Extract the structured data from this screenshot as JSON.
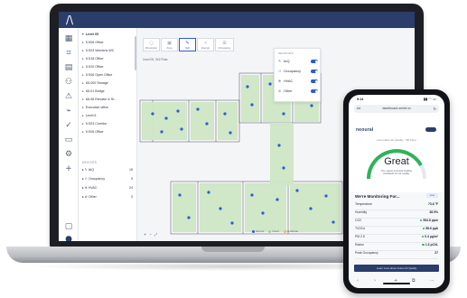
{
  "colors": {
    "brand_navy": "#2a3d6b",
    "accent_blue": "#2f5bd3",
    "plan_green": "#cfe7c6",
    "good_green": "#2fb35a"
  },
  "app": {
    "logo_glyph": "/\\",
    "rail_icons": [
      "building-icon",
      "floorplan-icon",
      "dashboard-icon",
      "people-icon",
      "alert-icon",
      "report-icon",
      "task-icon",
      "settings-icon",
      "add-icon",
      "chat-icon",
      "user-icon"
    ]
  },
  "tree": {
    "level": "Level 05",
    "items": [
      "5.S08 Office",
      "5.S03 Womens WC",
      "5.S18 Office",
      "5.S20 Office",
      "5.S06 Open Office",
      "A5.000 Storage",
      "A5.01 Bridge",
      "A5.06 Elevator & St...",
      "Executive office",
      "Level 6",
      "5.S03 Corridor",
      "5.S05 Office"
    ],
    "devices_label": "DEVICES",
    "devices": [
      {
        "name": "IAQ",
        "count": "15"
      },
      {
        "name": "Occupancy",
        "count": "5"
      },
      {
        "name": "HVAC",
        "count": "24"
      },
      {
        "name": "Other",
        "count": "3"
      }
    ]
  },
  "view_tabs": [
    {
      "label": "Dimension",
      "glyph": "▢"
    },
    {
      "label": "Area",
      "glyph": "▣"
    },
    {
      "label": "IAQ",
      "glyph": "✎"
    },
    {
      "label": "Energy",
      "glyph": "⚡"
    },
    {
      "label": "Occupancy",
      "glyph": "⊞"
    }
  ],
  "floor_caption": "Level 05, 3XZ Flats",
  "sensors_panel": {
    "header": "SENSORS",
    "rows": [
      {
        "label": "IAQ",
        "glyph": "✎"
      },
      {
        "label": "Occupancy",
        "glyph": "⚇"
      },
      {
        "label": "HVAC",
        "glyph": "❄"
      },
      {
        "label": "Other",
        "glyph": "⊘"
      }
    ]
  },
  "zoom": {
    "in": "+",
    "out": "−",
    "fit": "⤢"
  },
  "legend": [
    {
      "label": "Sensor"
    },
    {
      "label": "Good"
    },
    {
      "label": "Moderate"
    }
  ],
  "phone": {
    "time": "9:14",
    "signal": "▮▮ ◠ ▭",
    "url": "dashboard.sentei.io",
    "url_left": "AA",
    "url_reload": "↻",
    "brand": "neoural",
    "subtitle": "Live Indoor Air Quality · 5th Floor",
    "gauge_word": "Great",
    "gauge_desc": "The space exceeds healthy standards for air quality.",
    "monitoring_title": "We're Monitoring For...",
    "monitoring_chip": "Live",
    "metrics": [
      {
        "name": "Temperature",
        "value": "73.6 °F",
        "good": false
      },
      {
        "name": "Humidity",
        "value": "38.9%",
        "good": false
      },
      {
        "name": "CO2",
        "value": "554.8 ppm",
        "good": true
      },
      {
        "name": "TVOCs",
        "value": "58.6 ppb",
        "good": true
      },
      {
        "name": "PM 2.5",
        "value": "0.4 µg/m³",
        "good": true
      },
      {
        "name": "Radon",
        "value": "1.3 pCi/L",
        "good": true
      },
      {
        "name": "Peak Occupancy",
        "value": "27",
        "good": false
      }
    ],
    "cta": "Learn more about Indoor Air Quality",
    "nav": [
      "‹",
      "›",
      "+",
      "⧉",
      "⋯"
    ]
  }
}
